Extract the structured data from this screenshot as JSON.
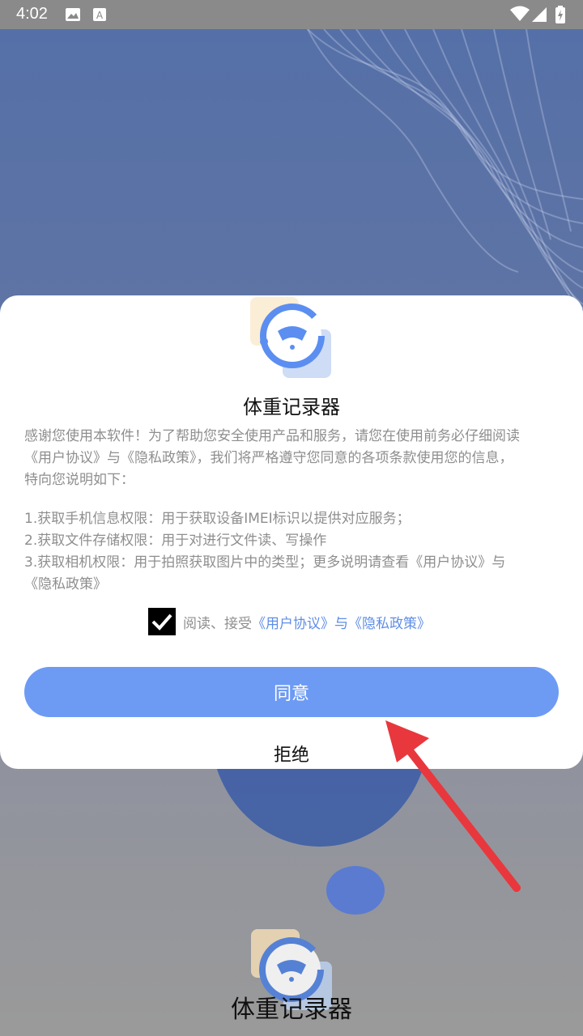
{
  "status_bar": {
    "time": "4:02"
  },
  "app_name": "体重记录器",
  "dialog": {
    "title": "体重记录器",
    "intro_lines": [
      "感谢您使用本软件！为了帮助您安全使用产品和服务，请您在使用前务必仔细阅读",
      "《用户协议》与《隐私政策》，我们将严格遵守您同意的各项条款使用您的信息，",
      "特向您说明如下："
    ],
    "permission_lines": [
      "1.获取手机信息权限：用于获取设备IMEI标识以提供对应服务；",
      "2.获取文件存储权限：用于对进行文件读、写操作",
      "3.获取相机权限：用于拍照获取图片中的类型；更多说明请查看《用户协议》与",
      "《隐私政策》"
    ],
    "agree_checked": true,
    "agree_prefix": "阅读、接受",
    "agree_link": "《用户协议》与《隐私政策》",
    "agree_button": "同意",
    "refuse_button": "拒绝"
  },
  "colors": {
    "accent": "#6d9bf4",
    "link": "#5f8ee6",
    "annotation_arrow": "#e8383d"
  },
  "icons": [
    "image-icon",
    "font-icon",
    "wifi-icon",
    "signal-icon",
    "battery-icon",
    "check-icon",
    "app-logo-icon",
    "red-arrow"
  ]
}
